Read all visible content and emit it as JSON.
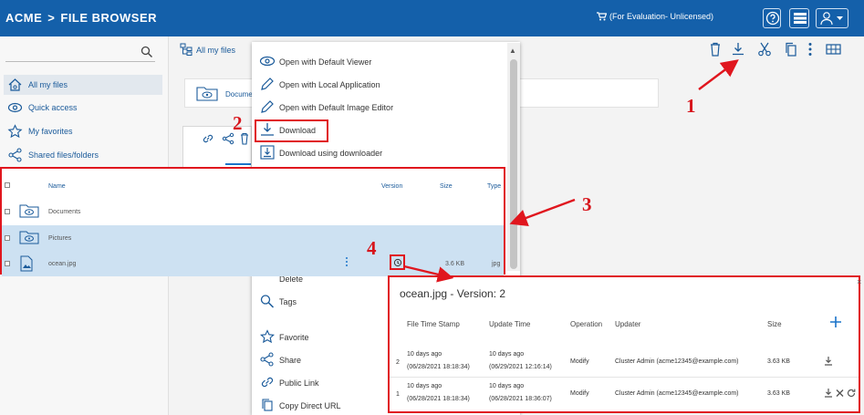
{
  "header": {
    "brand": "ACME",
    "separator": ">",
    "section": "FILE BROWSER",
    "license_note": "(For Evaluation- Unlicensed)"
  },
  "sidebar": {
    "items": [
      {
        "label": "All my files",
        "icon": "home-icon"
      },
      {
        "label": "Quick access",
        "icon": "eye-icon"
      },
      {
        "label": "My favorites",
        "icon": "star-icon"
      },
      {
        "label": "Shared files/folders",
        "icon": "share-icon"
      }
    ]
  },
  "breadcrumb": {
    "label": "All my files"
  },
  "background": {
    "documents_card": "Docume"
  },
  "context_menu": {
    "items": [
      "Open with Default Viewer",
      "Open with Local Application",
      "Open with Default Image Editor",
      "Download",
      "Download using downloader",
      "Delete",
      "Tags",
      "Favorite",
      "Share",
      "Public Link",
      "Copy Direct URL"
    ]
  },
  "file_list": {
    "columns": {
      "name": "Name",
      "version": "Version",
      "size": "Size",
      "type": "Type"
    },
    "rows": [
      {
        "name": "Documents",
        "size": "",
        "type": ""
      },
      {
        "name": "Pictures",
        "size": "",
        "type": ""
      },
      {
        "name": "ocean.jpg",
        "size": "3.6 KB",
        "type": "jpg"
      }
    ]
  },
  "version_panel": {
    "title": "ocean.jpg - Version: 2",
    "columns": [
      "File Time Stamp",
      "Update Time",
      "Operation",
      "Updater",
      "Size"
    ],
    "rows": [
      {
        "num": "2",
        "file_time": "10 days ago",
        "file_time_exact": "(06/28/2021 18:18:34)",
        "update_time": "10 days ago",
        "update_time_exact": "(06/29/2021 12:16:14)",
        "operation": "Modify",
        "updater": "Cluster Admin (acme12345@example.com)",
        "size": "3.63 KB"
      },
      {
        "num": "1",
        "file_time": "10 days ago",
        "file_time_exact": "(06/28/2021 18:18:34)",
        "update_time": "10 days ago",
        "update_time_exact": "(06/28/2021 18:36:07)",
        "operation": "Modify",
        "updater": "Cluster Admin (acme12345@example.com)",
        "size": "3.63 KB"
      }
    ]
  },
  "annotations": {
    "n1": "1",
    "n2": "2",
    "n3": "3",
    "n4": "4"
  },
  "colors": {
    "header": "#1460aa",
    "annotation": "#e0161e",
    "link": "#1a5a9a",
    "selected_row": "#cde1f2"
  }
}
